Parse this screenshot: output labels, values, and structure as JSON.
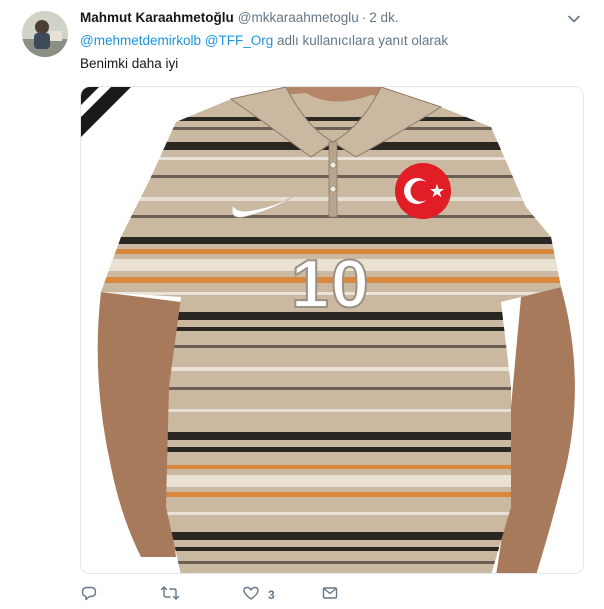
{
  "tweet": {
    "display_name": "Mahmut Karaahmetoğlu",
    "handle": "@mkkaraahmetoglu",
    "separator": "·",
    "time": "2 dk.",
    "reply_to": {
      "mention_1": "@mehmetdemirkolb",
      "mention_2": "@TFF_Org",
      "suffix": "adlı kullanıcılara yanıt olarak"
    },
    "text": "Benimki daha iyi",
    "media": {
      "description_icons": [
        "nike-swoosh",
        "turkish-flag-badge"
      ],
      "shirt_number": "10"
    },
    "actions": {
      "reply_icon": "reply-icon",
      "retweet_icon": "retweet-icon",
      "like_icon": "heart-icon",
      "like_count": "3",
      "dm_icon": "envelope-icon"
    }
  },
  "colors": {
    "link": "#1b95e0",
    "muted": "#657786",
    "text": "#14171a"
  }
}
